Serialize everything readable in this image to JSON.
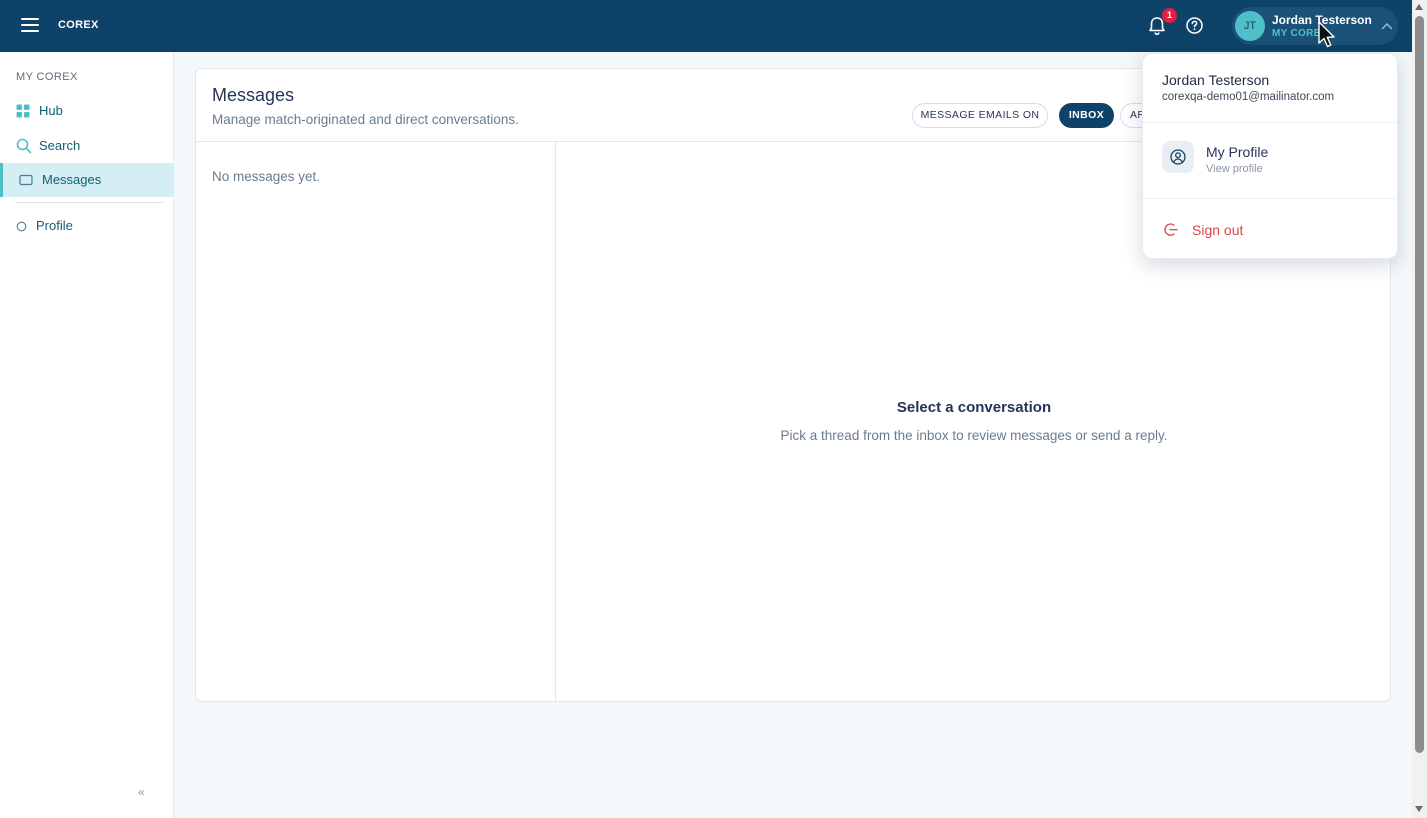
{
  "app": {
    "brand": "COREX"
  },
  "topbar": {
    "notifications_count": "1",
    "user": {
      "initials": "JT",
      "name": "Jordan Testerson",
      "subtitle": "MY COREX"
    }
  },
  "sidebar": {
    "section_label": "MY COREX",
    "items": [
      {
        "label": "Hub",
        "icon": "grid-icon"
      },
      {
        "label": "Search",
        "icon": "search-icon"
      },
      {
        "label": "Messages",
        "icon": "message-icon",
        "active": true
      },
      {
        "label": "Profile",
        "icon": "circle-icon"
      }
    ],
    "collapse_label": "«"
  },
  "messages": {
    "title": "Messages",
    "subtitle": "Manage match-originated and direct conversations.",
    "email_toggle_label": "MESSAGE EMAILS ON",
    "tabs": [
      {
        "label": "INBOX",
        "active": true
      },
      {
        "label": "AR"
      }
    ],
    "empty_list_text": "No messages yet.",
    "detail_title": "Select a conversation",
    "detail_subtitle": "Pick a thread from the inbox to review messages or send a reply."
  },
  "user_menu": {
    "name": "Jordan Testerson",
    "email": "corexqa-demo01@mailinator.com",
    "profile_label": "My Profile",
    "profile_sub": "View profile",
    "signout_label": "Sign out"
  },
  "colors": {
    "topbar": "#0f4268",
    "accent": "#4fc0c6",
    "danger": "#d94848",
    "badge": "#e11d48"
  }
}
